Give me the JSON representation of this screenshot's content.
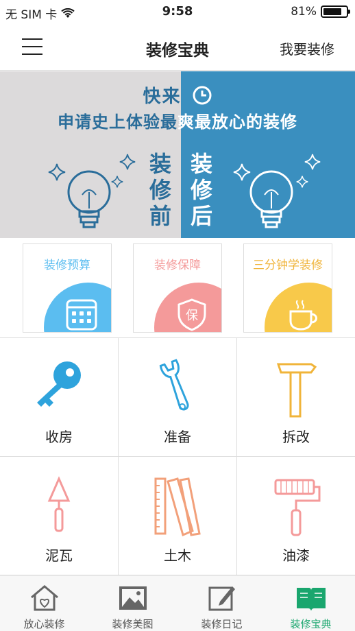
{
  "status_bar": {
    "carrier": "无 SIM 卡",
    "time": "9:58",
    "battery_text": "81%",
    "battery_level": 0.81
  },
  "nav": {
    "title": "装修宝典",
    "action": "我要装修"
  },
  "banner": {
    "line1": "快来",
    "line2_part1": "申请史上体验最",
    "line2_part2": "爽最放心的装修",
    "before": "装修前",
    "after": "装修后"
  },
  "cards": [
    {
      "title": "装修预算",
      "color": "#5bbdf0",
      "icon": "calculator-icon"
    },
    {
      "title": "装修保障",
      "color": "#f49a9a",
      "icon": "shield-icon"
    },
    {
      "title": "三分钟学装修",
      "color": "#f8c94a",
      "icon": "coffee-cup-icon"
    }
  ],
  "grid": [
    {
      "label": "收房",
      "icon": "key-icon"
    },
    {
      "label": "准备",
      "icon": "wrench-icon"
    },
    {
      "label": "拆改",
      "icon": "hammer-icon"
    },
    {
      "label": "泥瓦",
      "icon": "trowel-icon"
    },
    {
      "label": "土木",
      "icon": "ruler-icon"
    },
    {
      "label": "油漆",
      "icon": "paint-roller-icon"
    }
  ],
  "tabs": [
    {
      "label": "放心装修",
      "icon": "house-icon",
      "active": false
    },
    {
      "label": "装修美图",
      "icon": "image-icon",
      "active": false
    },
    {
      "label": "装修日记",
      "icon": "edit-icon",
      "active": false
    },
    {
      "label": "装修宝典",
      "icon": "book-icon",
      "active": true
    }
  ],
  "colors": {
    "accent_green": "#1aa66e",
    "banner_blue": "#3a8fbf",
    "banner_gray": "#dcdadb"
  }
}
